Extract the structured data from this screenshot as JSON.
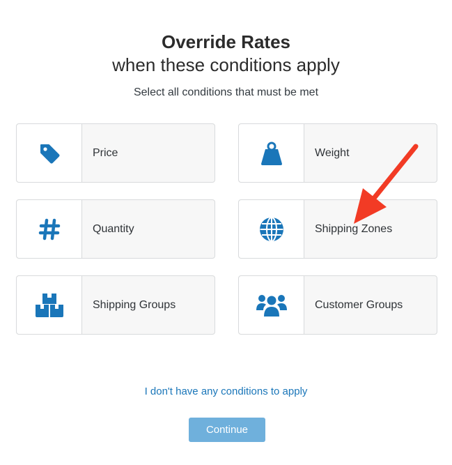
{
  "header": {
    "title": "Override Rates",
    "subtitle": "when these conditions apply",
    "instruction": "Select all conditions that must be met"
  },
  "conditions": [
    {
      "label": "Price",
      "icon": "tag-icon"
    },
    {
      "label": "Weight",
      "icon": "weight-icon"
    },
    {
      "label": "Quantity",
      "icon": "hash-icon"
    },
    {
      "label": "Shipping Zones",
      "icon": "globe-icon"
    },
    {
      "label": "Shipping Groups",
      "icon": "boxes-icon"
    },
    {
      "label": "Customer Groups",
      "icon": "users-icon"
    }
  ],
  "footer": {
    "skip_link": "I don't have any conditions to apply",
    "continue_label": "Continue"
  },
  "colors": {
    "icon": "#1a76b9",
    "link": "#1a76b9",
    "button": "#6fb0dc",
    "annotation_arrow": "#f23b25"
  }
}
